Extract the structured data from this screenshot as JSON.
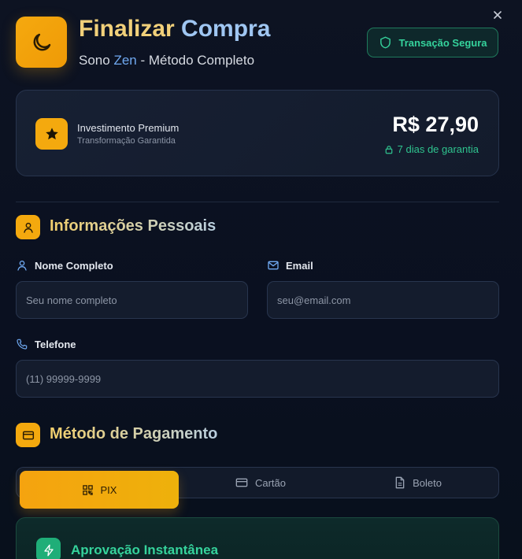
{
  "header": {
    "title_part1": "Finalizar",
    "title_part2": "Compra",
    "subtitle_prefix": "Sono",
    "subtitle_brand": "Zen",
    "subtitle_suffix": "- Método Completo",
    "secure_badge": "Transação Segura"
  },
  "price_card": {
    "title": "Investimento Premium",
    "subtitle": "Transformação Garantida",
    "price": "R$ 27,90",
    "guarantee": "7 dias de garantia"
  },
  "personal_section": {
    "title": "Informações Pessoais",
    "name_label": "Nome Completo",
    "name_placeholder": "Seu nome completo",
    "email_label": "Email",
    "email_placeholder": "seu@email.com",
    "phone_label": "Telefone",
    "phone_placeholder": "(11) 99999-9999"
  },
  "payment_section": {
    "title": "Método de Pagamento",
    "tabs": [
      {
        "label": "PIX",
        "icon": "qr-code-icon",
        "active": true
      },
      {
        "label": "Cartão",
        "icon": "credit-card-icon",
        "active": false
      },
      {
        "label": "Boleto",
        "icon": "document-icon",
        "active": false
      }
    ]
  },
  "approval": {
    "title": "Aprovação Instantânea"
  },
  "colors": {
    "accent": "#f4a90e",
    "success": "#35d39c",
    "link_blue": "#6fa8f0",
    "background": "#0d1322"
  }
}
